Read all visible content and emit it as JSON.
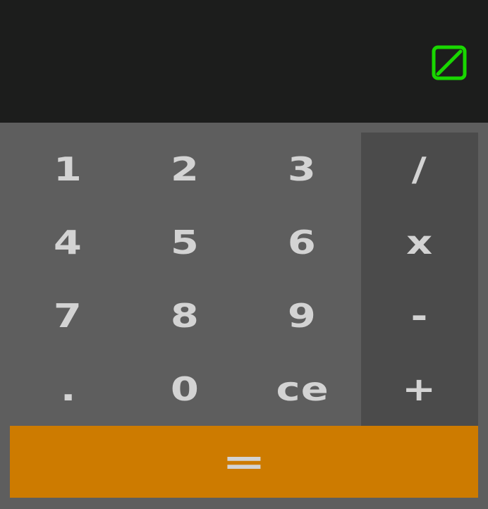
{
  "display": {
    "value": "",
    "indicator_icon": "square-slash-icon",
    "indicator_color": "#19d700"
  },
  "keys": {
    "row1": [
      "1",
      "2",
      "3",
      "/"
    ],
    "row2": [
      "4",
      "5",
      "6",
      "x"
    ],
    "row3": [
      "7",
      "8",
      "9",
      "-"
    ],
    "row4": [
      ".",
      "0",
      "ce",
      "+"
    ],
    "equals": "="
  },
  "colors": {
    "display_bg": "#1c1d1c",
    "keypad_bg": "#5e5e5e",
    "operator_bg": "#4b4b4b",
    "equals_bg": "#cd7b00",
    "key_text": "#d3d3d3"
  }
}
